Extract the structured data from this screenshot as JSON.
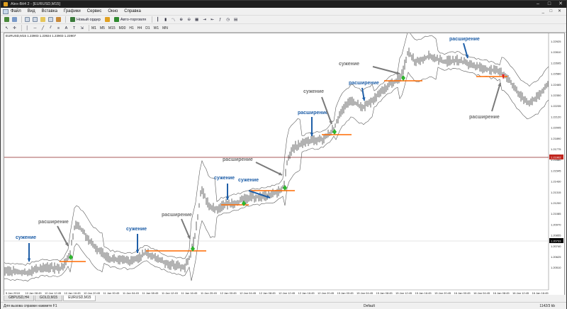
{
  "window": {
    "title": "Alex-Bit4 2 - [EURUSD,M15]",
    "controls": [
      "–",
      "□",
      "✕"
    ]
  },
  "menu": {
    "items": [
      "Файл",
      "Вид",
      "Вставка",
      "Графики",
      "Сервис",
      "Окно",
      "Справка"
    ],
    "doc_controls": "_ □ ✕"
  },
  "toolbar": {
    "new_order_label": "Новый ордер",
    "autotrading_label": "Авто-торговля",
    "timeframes": [
      "M1",
      "M5",
      "M15",
      "M30",
      "H1",
      "H4",
      "D1",
      "W1",
      "MN"
    ]
  },
  "chart": {
    "symbol_title": "EURUSD,M15  1.23903 1.23924 1.23903 1.23907",
    "background": "#ffffff",
    "price_color": "#000000",
    "band_color": "#5a5a5a",
    "level_color": "#ff6a00",
    "marker_color": "#2cb52c",
    "down_marker_color": "#e02020",
    "blue_color": "#1f5fa8",
    "gray_color": "#7a7a7a",
    "price_axis": [
      "1.22925",
      "1.22810",
      "1.22695",
      "1.22580",
      "1.22465",
      "1.22350",
      "1.22235",
      "1.22120",
      "1.22005",
      "1.21890",
      "1.21775",
      "1.21660",
      "1.21545",
      "1.21430",
      "1.21315",
      "1.21200",
      "1.21085",
      "1.20970",
      "1.20855",
      "1.20740",
      "1.20625",
      "1.20510"
    ],
    "current_price_tag": "1.21902",
    "lower_price_tag": "1.20733",
    "time_axis": [
      "5 Jan 2018",
      "10 Jan 08:45",
      "10 Jan 12:45",
      "10 Jan 16:45",
      "10 Jan 20:45",
      "11 Jan 00:45",
      "11 Jan 04:45",
      "11 Jan 08:45",
      "11 Jan 12:45",
      "11 Jan 16:45",
      "11 Jan 20:45",
      "12 Jan 00:45",
      "12 Jan 04:45",
      "12 Jan 08:45",
      "12 Jan 12:45",
      "12 Jan 16:45",
      "12 Jan 20:45",
      "15 Jan 00:45",
      "15 Jan 04:45",
      "15 Jan 08:45",
      "15 Jan 12:45",
      "15 Jan 16:45",
      "15 Jan 20:45",
      "16 Jan 00:45",
      "16 Jan 04:45",
      "16 Jan 08:45",
      "16 Jan 12:45",
      "16 Jan 16:45"
    ],
    "annotations": [
      {
        "text": "сужение",
        "kind": "squeeze"
      },
      {
        "text": "расширение",
        "kind": "expansion"
      },
      {
        "text": "сужение",
        "kind": "squeeze"
      },
      {
        "text": "расширение",
        "kind": "expansion"
      },
      {
        "text": "сужение",
        "kind": "squeeze"
      },
      {
        "text": "расширение",
        "kind": "expansion"
      },
      {
        "text": "сужение",
        "kind": "squeeze"
      },
      {
        "text": "расширение",
        "kind": "expansion"
      },
      {
        "text": "сужение",
        "kind": "squeeze"
      },
      {
        "text": "расширение",
        "kind": "expansion"
      },
      {
        "text": "сужение",
        "kind": "squeeze"
      },
      {
        "text": "расширение",
        "kind": "expansion"
      }
    ]
  },
  "tabs": [
    "GBPUSD,H4",
    "GOLD,M15",
    "EURUSD,M15"
  ],
  "active_tab": "EURUSD,M15",
  "status": {
    "help": "Для вызова справки нажмите F1",
    "profile": "Default",
    "traffic": "1142/3 kb"
  }
}
